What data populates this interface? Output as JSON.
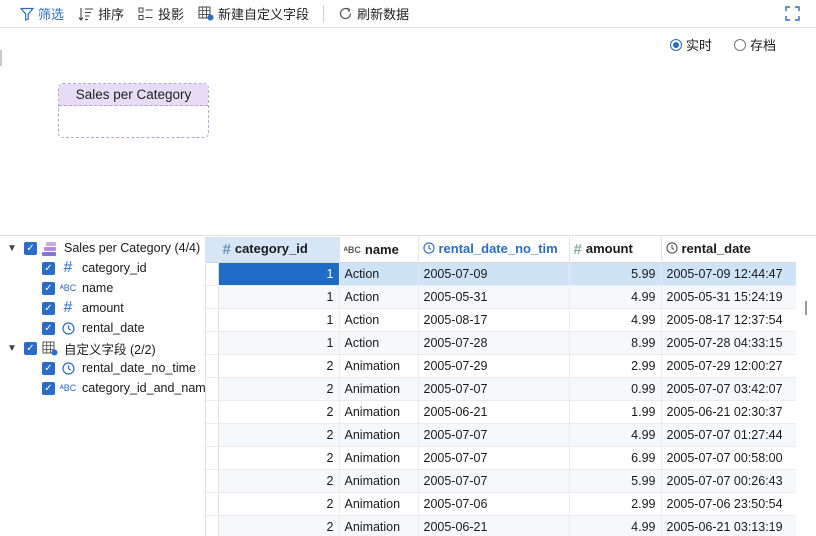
{
  "toolbar": {
    "filter": "筛选",
    "sort": "排序",
    "project": "投影",
    "new_field": "新建自定义字段",
    "refresh": "刷新数据"
  },
  "mode": {
    "realtime": "实时",
    "archive": "存档",
    "selected": "realtime"
  },
  "card": {
    "title": "Sales per Category"
  },
  "tree": {
    "group1": "Sales per Category (4/4)",
    "fields1": [
      "category_id",
      "name",
      "amount",
      "rental_date"
    ],
    "group2": "自定义字段 (2/2)",
    "fields2": [
      "rental_date_no_time",
      "category_id_and_name"
    ]
  },
  "grid": {
    "columns": [
      "category_id",
      "name",
      "rental_date_no_tim",
      "amount",
      "rental_date"
    ],
    "rows": [
      [
        "1",
        "Action",
        "2005-07-09",
        "5.99",
        "2005-07-09 12:44:47"
      ],
      [
        "1",
        "Action",
        "2005-05-31",
        "4.99",
        "2005-05-31 15:24:19"
      ],
      [
        "1",
        "Action",
        "2005-08-17",
        "4.99",
        "2005-08-17 12:37:54"
      ],
      [
        "1",
        "Action",
        "2005-07-28",
        "8.99",
        "2005-07-28 04:33:15"
      ],
      [
        "2",
        "Animation",
        "2005-07-29",
        "2.99",
        "2005-07-29 12:00:27"
      ],
      [
        "2",
        "Animation",
        "2005-07-07",
        "0.99",
        "2005-07-07 03:42:07"
      ],
      [
        "2",
        "Animation",
        "2005-06-21",
        "1.99",
        "2005-06-21 02:30:37"
      ],
      [
        "2",
        "Animation",
        "2005-07-07",
        "4.99",
        "2005-07-07 01:27:44"
      ],
      [
        "2",
        "Animation",
        "2005-07-07",
        "6.99",
        "2005-07-07 00:58:00"
      ],
      [
        "2",
        "Animation",
        "2005-07-07",
        "5.99",
        "2005-07-07 00:26:43"
      ],
      [
        "2",
        "Animation",
        "2005-07-06",
        "2.99",
        "2005-07-06 23:50:54"
      ],
      [
        "2",
        "Animation",
        "2005-06-21",
        "4.99",
        "2005-06-21 03:13:19"
      ]
    ]
  },
  "colors": {
    "accent": "#2b6cc4",
    "card_header": "#e6dcf5",
    "selected_row": "#cfe3f7"
  }
}
